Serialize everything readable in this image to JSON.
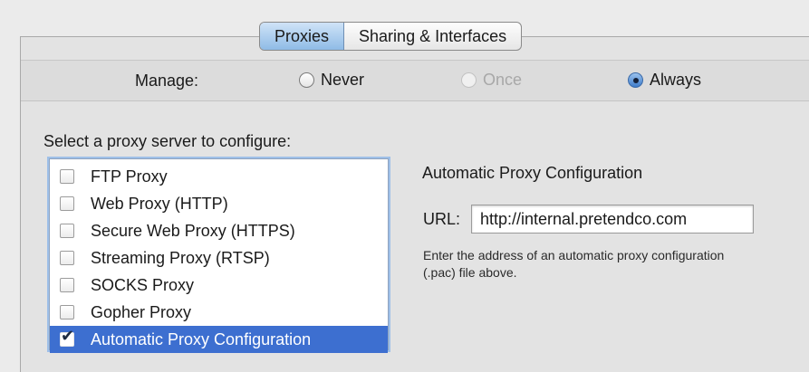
{
  "tabs": [
    {
      "label": "Proxies",
      "selected": true
    },
    {
      "label": "Sharing & Interfaces",
      "selected": false
    }
  ],
  "manage": {
    "label": "Manage:",
    "options": [
      {
        "label": "Never",
        "state": "unchecked"
      },
      {
        "label": "Once",
        "state": "disabled"
      },
      {
        "label": "Always",
        "state": "checked"
      }
    ]
  },
  "proxy_list": {
    "label": "Select a proxy server to configure:",
    "items": [
      {
        "label": "FTP Proxy",
        "checked": false
      },
      {
        "label": "Web Proxy (HTTP)",
        "checked": false
      },
      {
        "label": "Secure Web Proxy (HTTPS)",
        "checked": false
      },
      {
        "label": "Streaming Proxy (RTSP)",
        "checked": false
      },
      {
        "label": "SOCKS Proxy",
        "checked": false
      },
      {
        "label": "Gopher Proxy",
        "checked": false
      },
      {
        "label": "Automatic Proxy Configuration",
        "checked": true
      }
    ]
  },
  "config": {
    "title": "Automatic Proxy Configuration",
    "url_label": "URL:",
    "url_value": "http://internal.pretendco.com",
    "help": "Enter the address of an automatic proxy configuration (.pac) file above."
  }
}
